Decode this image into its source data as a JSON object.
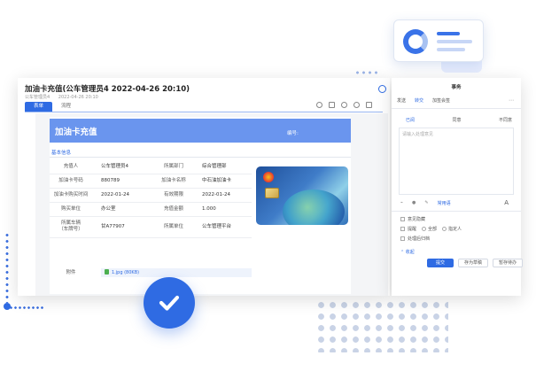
{
  "window": {
    "title": "加油卡充值(公车管理员4 2022-04-26 20:10)",
    "subtitle": [
      "公车管理员4",
      "2022-04-26 20:10"
    ],
    "tabs": [
      "表单",
      "流程"
    ]
  },
  "form": {
    "header_title": "加油卡充值",
    "number_label": "编号:",
    "section_title": "基本信息",
    "rows": [
      {
        "l1": "充值人",
        "v1": "公车管理员4",
        "l2": "所属部门",
        "v2": "综合管理部"
      },
      {
        "l1": "加油卡号码",
        "v1": "880789",
        "l2": "加油卡名称",
        "v2": "中石油加油卡"
      },
      {
        "l1": "加油卡购买时间",
        "v1": "2022-01-24",
        "l2": "有效期限",
        "v2": "2022-01-24"
      },
      {
        "l1": "购买单位",
        "v1": "办公室",
        "l2": "充值金额",
        "v2": "1.000"
      },
      {
        "l1": "所属车辆\n（车牌号）",
        "v1": "甘A77907",
        "l2": "所属单位",
        "v2": "公车管理平台"
      }
    ],
    "attachment_label": "附件",
    "attachment_file": "1.jpg (80KB)"
  },
  "panel": {
    "title": "事务",
    "tabs": [
      "发送",
      "转交",
      "加签会签"
    ],
    "opinion_options": [
      "已阅",
      "同意",
      "不同意"
    ],
    "opinion_placeholder": "请输入处理意见",
    "opinion_link": "常用语",
    "checks": {
      "c1": "意见隐藏",
      "c2": "提醒",
      "r1": "全部",
      "r2": "指定人",
      "c3": "处理后归档"
    },
    "collapse": "收起",
    "buttons": [
      "提交",
      "存为草稿",
      "暂存待办"
    ]
  },
  "icons": {
    "toolbar": [
      "print-icon",
      "history-icon",
      "attach-icon",
      "search-icon",
      "more-icon"
    ],
    "badge": "check-icon"
  },
  "colors": {
    "accent": "#2f6be3",
    "form_header": "#6a95ee"
  }
}
